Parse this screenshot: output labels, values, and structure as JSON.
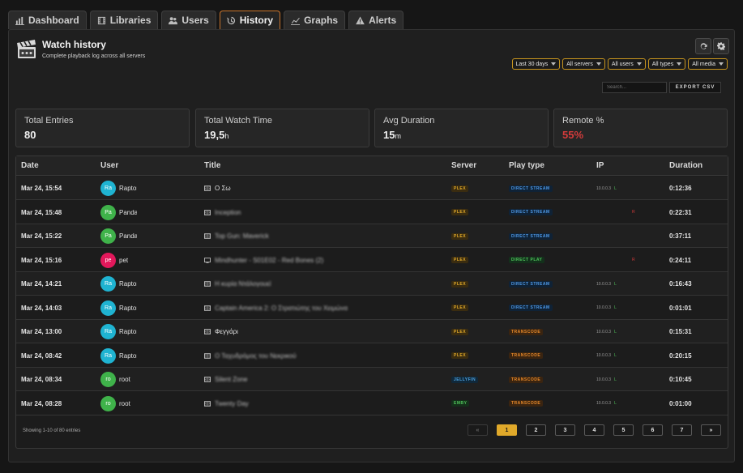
{
  "tabs": [
    {
      "label": "Dashboard",
      "icon": "bar-chart-icon"
    },
    {
      "label": "Libraries",
      "icon": "film-icon"
    },
    {
      "label": "Users",
      "icon": "users-icon"
    },
    {
      "label": "History",
      "icon": "history-icon"
    },
    {
      "label": "Graphs",
      "icon": "line-chart-icon"
    },
    {
      "label": "Alerts",
      "icon": "warning-icon"
    }
  ],
  "header": {
    "title": "Watch history",
    "subtitle": "Complete playback log across all servers"
  },
  "filters": [
    "Last 30 days",
    "All servers",
    "All users",
    "All types",
    "All media"
  ],
  "search": {
    "placeholder": "Search..."
  },
  "export_label": "EXPORT CSV",
  "stats": [
    {
      "label": "Total Entries",
      "value": "80",
      "unit": ""
    },
    {
      "label": "Total Watch Time",
      "value": "19,5",
      "unit": "h"
    },
    {
      "label": "Avg Duration",
      "value": "15",
      "unit": "m"
    },
    {
      "label": "Remote %",
      "value": "55%",
      "unit": ""
    }
  ],
  "columns": [
    "Date",
    "User",
    "Title",
    "Server",
    "Play type",
    "IP",
    "Duration"
  ],
  "rows": [
    {
      "date": "Mar 24, 15:54",
      "initials": "Ra",
      "avatar_color": "#1fb3d1",
      "user": "Raptor",
      "title": "Ο Σω",
      "blur": false,
      "server": "PLEX",
      "play_type": "DIRECT STREAM",
      "ip": "10.0.0.3",
      "ip_flag": "L",
      "duration": "0:12:36"
    },
    {
      "date": "Mar 24, 15:48",
      "initials": "Pa",
      "avatar_color": "#3fb24a",
      "user": "Panda",
      "title": "Inception",
      "blur": true,
      "server": "PLEX",
      "play_type": "DIRECT STREAM",
      "ip": "",
      "ip_flag": "R",
      "duration": "0:22:31"
    },
    {
      "date": "Mar 24, 15:22",
      "initials": "Pa",
      "avatar_color": "#3fb24a",
      "user": "Panda",
      "title": "Top Gun: Maverick",
      "blur": true,
      "server": "PLEX",
      "play_type": "DIRECT STREAM",
      "ip": "",
      "ip_flag": "",
      "duration": "0:37:11"
    },
    {
      "date": "Mar 24, 15:16",
      "initials": "pe",
      "avatar_color": "#e2185b",
      "user": "pet",
      "title": "Mindhunter - S01E02 - Red Bones (2)",
      "blur": true,
      "server": "PLEX",
      "play_type": "DIRECT PLAY",
      "ip": "",
      "ip_flag": "R",
      "duration": "0:24:11"
    },
    {
      "date": "Mar 24, 14:21",
      "initials": "Ra",
      "avatar_color": "#1fb3d1",
      "user": "Raptor",
      "title": "Η κυρία Ντάλογουεϊ",
      "blur": true,
      "server": "PLEX",
      "play_type": "DIRECT STREAM",
      "ip": "10.0.0.3",
      "ip_flag": "L",
      "duration": "0:16:43"
    },
    {
      "date": "Mar 24, 14:03",
      "initials": "Ra",
      "avatar_color": "#1fb3d1",
      "user": "Raptor",
      "title": "Captain America 2: Ο Στρατιώτης του Χειμώνα",
      "blur": true,
      "server": "PLEX",
      "play_type": "DIRECT STREAM",
      "ip": "10.0.0.3",
      "ip_flag": "L",
      "duration": "0:01:01"
    },
    {
      "date": "Mar 24, 13:00",
      "initials": "Ra",
      "avatar_color": "#1fb3d1",
      "user": "Raptor",
      "title": "Φεγγάρι",
      "blur": false,
      "server": "PLEX",
      "play_type": "TRANSCODE",
      "ip": "10.0.0.3",
      "ip_flag": "L",
      "duration": "0:15:31"
    },
    {
      "date": "Mar 24, 08:42",
      "initials": "Ra",
      "avatar_color": "#1fb3d1",
      "user": "Raptor",
      "title": "Ο Ταχυδρόμος του Νεκρικού",
      "blur": true,
      "server": "PLEX",
      "play_type": "TRANSCODE",
      "ip": "10.0.0.3",
      "ip_flag": "L",
      "duration": "0:20:15"
    },
    {
      "date": "Mar 24, 08:34",
      "initials": "ro",
      "avatar_color": "#3fb24a",
      "user": "root",
      "title": "Silent Zone",
      "blur": true,
      "server": "JELLYFIN",
      "play_type": "TRANSCODE",
      "ip": "10.0.0.3",
      "ip_flag": "L",
      "duration": "0:10:45"
    },
    {
      "date": "Mar 24, 08:28",
      "initials": "ro",
      "avatar_color": "#3fb24a",
      "user": "root",
      "title": "Twenty Day",
      "blur": true,
      "server": "EMBY",
      "play_type": "TRANSCODE",
      "ip": "10.0.0.3",
      "ip_flag": "L",
      "duration": "0:01:00"
    }
  ],
  "footer": {
    "summary": "Showing 1-10 of 80 entries"
  },
  "pagination": [
    "«",
    "1",
    "2",
    "3",
    "4",
    "5",
    "6",
    "7",
    "»"
  ],
  "accent_color": "#e0a92a"
}
